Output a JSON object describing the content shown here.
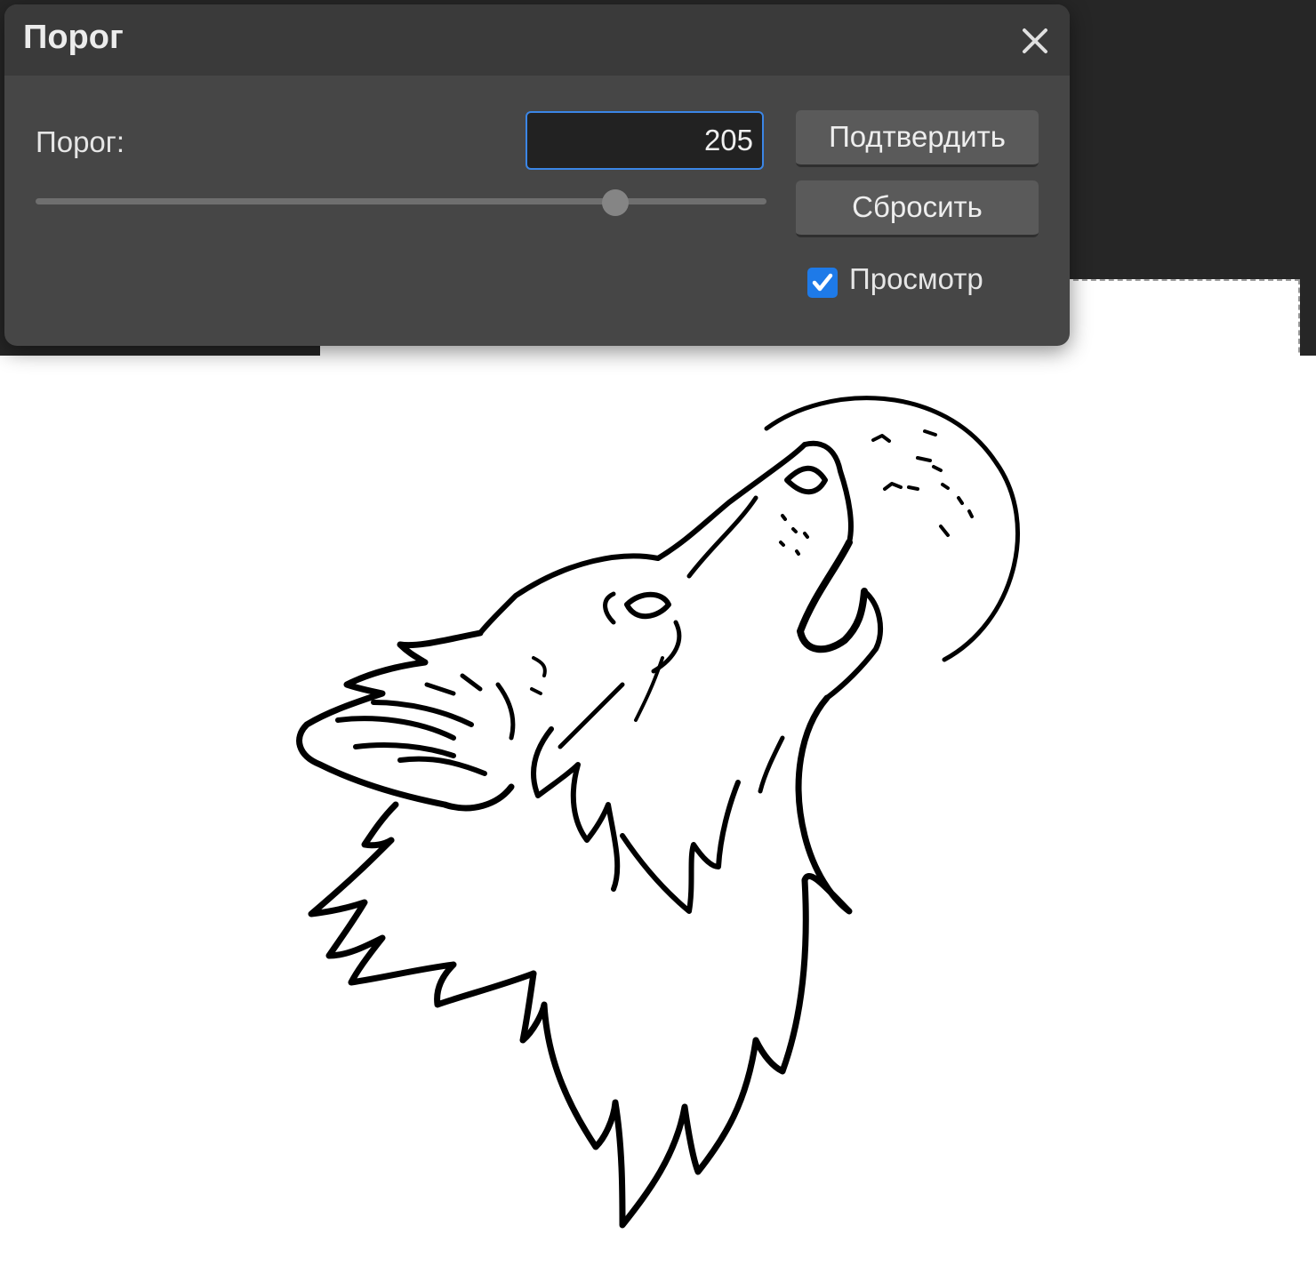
{
  "dialog": {
    "title": "Порог",
    "threshold_label": "Порог:",
    "threshold_value": "205",
    "slider_value": 205,
    "slider_max": 255,
    "confirm_label": "Подтвердить",
    "reset_label": "Сбросить",
    "preview_label": "Просмотр",
    "preview_checked": true,
    "close_icon": "close-icon",
    "accent_color": "#1e7ae8"
  },
  "canvas": {
    "image_icon": "howling-wolf-moon-drawing"
  }
}
